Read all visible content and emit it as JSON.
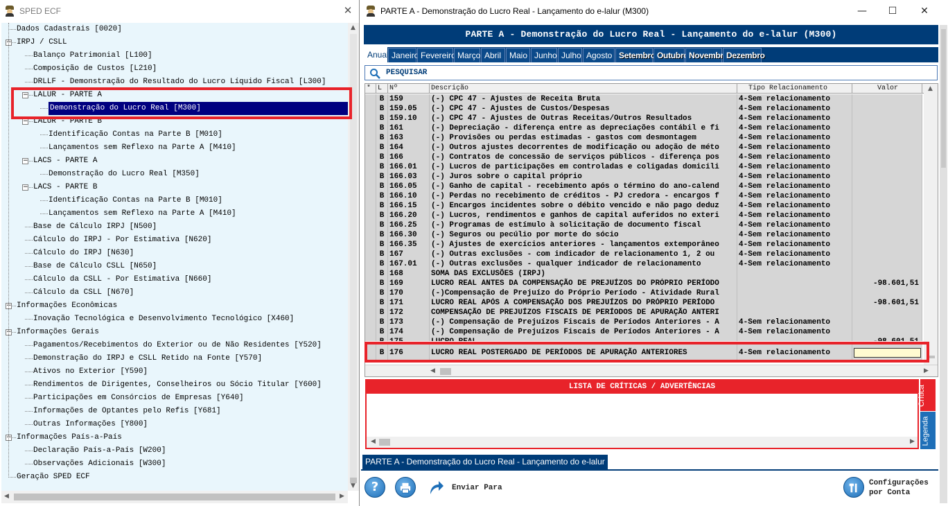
{
  "left_window": {
    "title": "SPED ECF",
    "tree": [
      {
        "label": "Dados Cadastrais [0020]",
        "level": 0
      },
      {
        "label": "IRPJ / CSLL",
        "level": 0,
        "expanded": true
      },
      {
        "label": "Balanço Patrimonial [L100]",
        "level": 1
      },
      {
        "label": "Composição de Custos [L210]",
        "level": 1
      },
      {
        "label": "DRLLF - Demonstração do Resultado do Lucro Líquido Fiscal [L300]",
        "level": 1
      },
      {
        "label": "LALUR - PARTE A",
        "level": 1,
        "expanded": true
      },
      {
        "label": "Demonstração do Lucro Real [M300]",
        "level": 2,
        "selected": true
      },
      {
        "label": "LALUR - PARTE B",
        "level": 1,
        "expanded": true
      },
      {
        "label": "Identificação Contas na Parte B [M010]",
        "level": 2
      },
      {
        "label": "Lançamentos sem Reflexo na Parte A [M410]",
        "level": 2
      },
      {
        "label": "LACS - PARTE A",
        "level": 1,
        "expanded": true
      },
      {
        "label": "Demonstração do Lucro Real [M350]",
        "level": 2
      },
      {
        "label": "LACS - PARTE B",
        "level": 1,
        "expanded": true
      },
      {
        "label": "Identificação Contas na Parte B [M010]",
        "level": 2
      },
      {
        "label": "Lançamentos sem Reflexo na Parte A [M410]",
        "level": 2
      },
      {
        "label": "Base de Cálculo IRPJ [N500]",
        "level": 1
      },
      {
        "label": "Cálculo do IRPJ - Por Estimativa [N620]",
        "level": 1
      },
      {
        "label": "Cálculo do IRPJ [N630]",
        "level": 1
      },
      {
        "label": "Base de Cálculo CSLL [N650]",
        "level": 1
      },
      {
        "label": "Cálculo da CSLL - Por Estimativa [N660]",
        "level": 1
      },
      {
        "label": "Cálculo da CSLL [N670]",
        "level": 1
      },
      {
        "label": "Informações Econômicas",
        "level": 0,
        "expanded": true
      },
      {
        "label": "Inovação Tecnológica e Desenvolvimento Tecnológico [X460]",
        "level": 1
      },
      {
        "label": "Informações Gerais",
        "level": 0,
        "expanded": true
      },
      {
        "label": "Pagamentos/Recebimentos do Exterior ou de Não Residentes [Y520]",
        "level": 1
      },
      {
        "label": "Demonstração do IRPJ e CSLL Retido na Fonte [Y570]",
        "level": 1
      },
      {
        "label": "Ativos no Exterior [Y590]",
        "level": 1
      },
      {
        "label": "Rendimentos de Dirigentes, Conselheiros ou Sócio Titular [Y600]",
        "level": 1
      },
      {
        "label": "Participações em Consórcios de Empresas [Y640]",
        "level": 1
      },
      {
        "label": "Informações de Optantes pelo Refis [Y681]",
        "level": 1
      },
      {
        "label": "Outras Informações [Y800]",
        "level": 1
      },
      {
        "label": "Informações País-a-País",
        "level": 0,
        "expanded": true
      },
      {
        "label": "Declaração País-a-País [W200]",
        "level": 1
      },
      {
        "label": "Observações Adicionais [W300]",
        "level": 1
      },
      {
        "label": "Geração SPED ECF",
        "level": 0
      }
    ]
  },
  "right_window": {
    "title": "PARTE A - Demonstração do Lucro Real - Lançamento do e-lalur (M300)",
    "banner": "PARTE A - Demonstração do Lucro Real - Lançamento do e-lalur (M300)",
    "tabs": [
      "Anual",
      "Janeiro",
      "Fevereiro",
      "Março",
      "Abril",
      "Maio",
      "Junho",
      "Julho",
      "Agosto",
      "Setembro",
      "Outubro",
      "Novembro",
      "Dezembro"
    ],
    "active_tab": "Anual",
    "search_label": "PESQUISAR",
    "columns": [
      "*",
      "L",
      "Nº",
      "Descrição",
      "Tipo Relacionamento",
      "Valor"
    ],
    "rows": [
      {
        "l": "B",
        "n": "159",
        "desc": "(-) CPC 47 - Ajustes de Receita Bruta",
        "tipo": "4-Sem relacionamento",
        "valor": ""
      },
      {
        "l": "B",
        "n": "159.05",
        "desc": "(-) CPC 47 - Ajustes de Custos/Despesas",
        "tipo": "4-Sem relacionamento",
        "valor": ""
      },
      {
        "l": "B",
        "n": "159.10",
        "desc": "(-) CPC 47 - Ajustes de Outras Receitas/Outros Resultados",
        "tipo": "4-Sem relacionamento",
        "valor": ""
      },
      {
        "l": "B",
        "n": "161",
        "desc": "(-) Depreciação - diferença entre as depreciações contábil e fi",
        "tipo": "4-Sem relacionamento",
        "valor": ""
      },
      {
        "l": "B",
        "n": "163",
        "desc": "(-) Provisões ou perdas estimadas - gastos com desmontagem",
        "tipo": "4-Sem relacionamento",
        "valor": ""
      },
      {
        "l": "B",
        "n": "164",
        "desc": "(-) Outros ajustes decorrentes de modificação ou adoção de méto",
        "tipo": "4-Sem relacionamento",
        "valor": ""
      },
      {
        "l": "B",
        "n": "166",
        "desc": "(-) Contratos de concessão de serviços públicos - diferença pos",
        "tipo": "4-Sem relacionamento",
        "valor": ""
      },
      {
        "l": "B",
        "n": "166.01",
        "desc": "(-) Lucros de participações em controladas e coligadas domicili",
        "tipo": "4-Sem relacionamento",
        "valor": ""
      },
      {
        "l": "B",
        "n": "166.03",
        "desc": "(-) Juros sobre o capital próprio",
        "tipo": "4-Sem relacionamento",
        "valor": ""
      },
      {
        "l": "B",
        "n": "166.05",
        "desc": "(-) Ganho de capital - recebimento após o término do ano-calend",
        "tipo": "4-Sem relacionamento",
        "valor": ""
      },
      {
        "l": "B",
        "n": "166.10",
        "desc": "(-) Perdas no recebimento de créditos - PJ credora - encargos f",
        "tipo": "4-Sem relacionamento",
        "valor": ""
      },
      {
        "l": "B",
        "n": "166.15",
        "desc": "(-) Encargos incidentes sobre o débito vencido e não pago deduz",
        "tipo": "4-Sem relacionamento",
        "valor": ""
      },
      {
        "l": "B",
        "n": "166.20",
        "desc": "(-) Lucros, rendimentos e ganhos de capital auferidos no exteri",
        "tipo": "4-Sem relacionamento",
        "valor": ""
      },
      {
        "l": "B",
        "n": "166.25",
        "desc": "(-) Programas de estímulo à solicitação de documento fiscal",
        "tipo": "4-Sem relacionamento",
        "valor": ""
      },
      {
        "l": "B",
        "n": "166.30",
        "desc": "(-) Seguros ou pecúlio por morte do sócio",
        "tipo": "4-Sem relacionamento",
        "valor": ""
      },
      {
        "l": "B",
        "n": "166.35",
        "desc": "(-) Ajustes de exercícios anteriores - lançamentos extemporâneo",
        "tipo": "4-Sem relacionamento",
        "valor": ""
      },
      {
        "l": "B",
        "n": "167",
        "desc": "(-) Outras exclusões - com indicador de relacionamento 1, 2 ou",
        "tipo": "4-Sem relacionamento",
        "valor": ""
      },
      {
        "l": "B",
        "n": "167.01",
        "desc": "(-) Outras exclusões - qualquer indicador de relacionamento",
        "tipo": "4-Sem relacionamento",
        "valor": ""
      },
      {
        "l": "B",
        "n": "168",
        "desc": "SOMA DAS EXCLUSÕES (IRPJ)",
        "tipo": "",
        "valor": ""
      },
      {
        "l": "B",
        "n": "169",
        "desc": "LUCRO REAL ANTES DA COMPENSAÇÃO DE PREJUÍZOS DO PRÓPRIO PERÍODO",
        "tipo": "",
        "valor": "-98.601,51"
      },
      {
        "l": "B",
        "n": "170",
        "desc": "(-)Compensação de Prejuízo do Próprio Período - Atividade Rural",
        "tipo": "",
        "valor": ""
      },
      {
        "l": "B",
        "n": "171",
        "desc": "LUCRO REAL APÓS A COMPENSAÇÃO DOS PREJUÍZOS DO PRÓPRIO PERÍODO",
        "tipo": "",
        "valor": "-98.601,51"
      },
      {
        "l": "B",
        "n": "172",
        "desc": "COMPENSAÇÃO DE PREJUÍZOS FISCAIS DE PERÍODOS DE APURAÇÃO ANTERI",
        "tipo": "",
        "valor": ""
      },
      {
        "l": "B",
        "n": "173",
        "desc": "(-) Compensação de Prejuízos Fiscais de Períodos Anteriores - A",
        "tipo": "4-Sem relacionamento",
        "valor": ""
      },
      {
        "l": "B",
        "n": "174",
        "desc": "(-) Compensação de Prejuízos Fiscais de Períodos Anteriores - A",
        "tipo": "4-Sem relacionamento",
        "valor": ""
      },
      {
        "l": "B",
        "n": "175",
        "desc": "LUCRO REAL",
        "tipo": "",
        "valor": "-98.601,51"
      }
    ],
    "highlight_row": {
      "l": "B",
      "n": "176",
      "desc": "LUCRO REAL POSTERGADO DE PERÍODOS DE APURAÇÃO ANTERIORES",
      "tipo": "4-Sem relacionamento",
      "valor": ""
    },
    "critics_title": "LISTA DE CRÍTICAS / ADVERTÊNCIAS",
    "side_tabs": [
      "Crítica",
      "Legenda"
    ],
    "status_tab": "PARTE A - Demonstração do Lucro Real - Lançamento do e-lalur",
    "toolbar": {
      "help": "?",
      "enviar": "Enviar Para",
      "config_line1": "Configurações",
      "config_line2": "por Conta"
    }
  }
}
